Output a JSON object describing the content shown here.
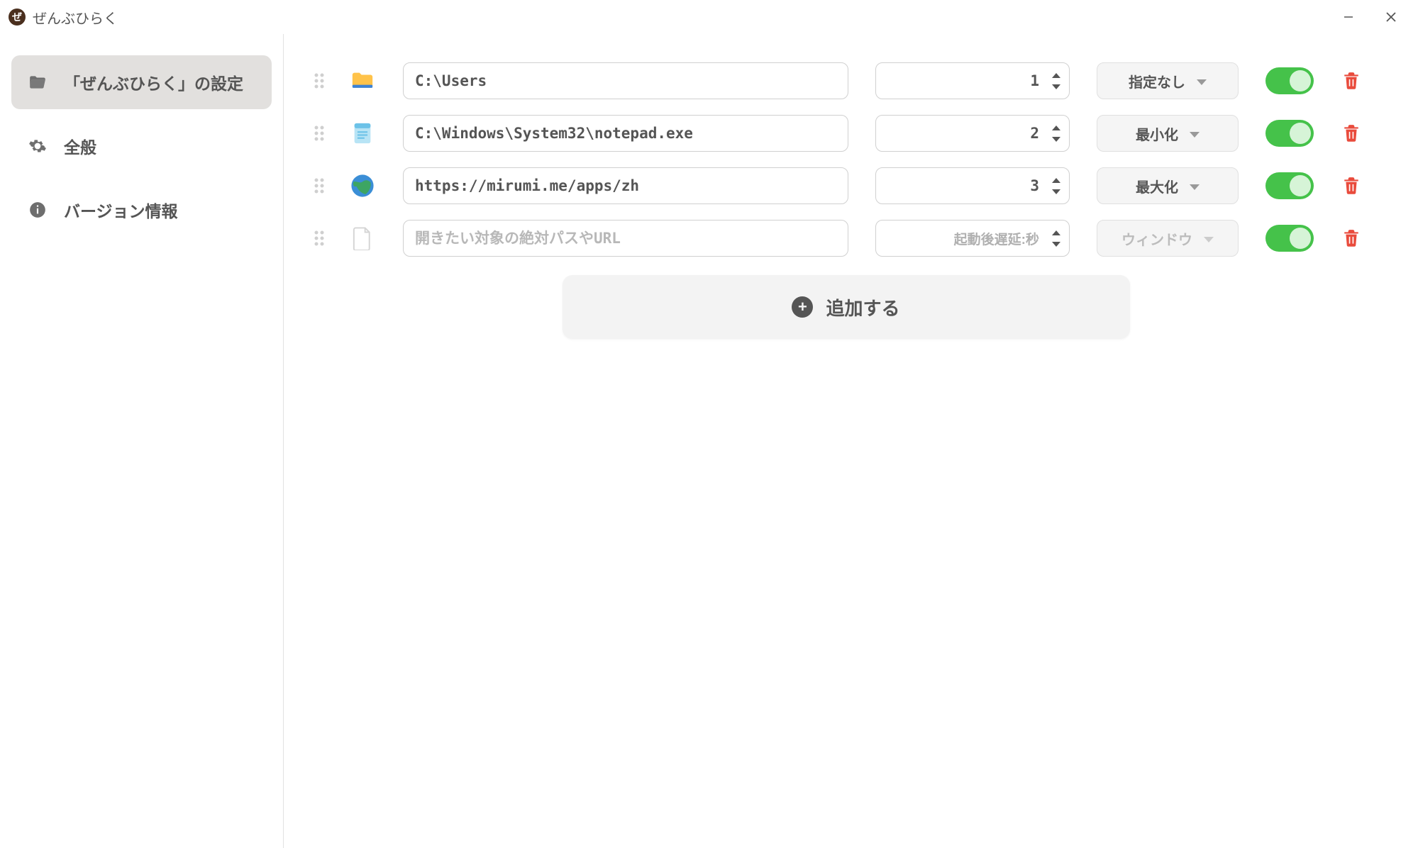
{
  "titlebar": {
    "app_title": "ぜんぶひらく",
    "app_icon_char": "ぜ"
  },
  "sidebar": {
    "items": [
      {
        "label": "「ぜんぶひらく」の設定"
      },
      {
        "label": "全般"
      },
      {
        "label": "バージョン情報"
      }
    ]
  },
  "rows": [
    {
      "path": "C:\\Users",
      "delay": "1",
      "window": "指定なし",
      "icon": "folder"
    },
    {
      "path": "C:\\Windows\\System32\\notepad.exe",
      "delay": "2",
      "window": "最小化",
      "icon": "notepad"
    },
    {
      "path": "https://mirumi.me/apps/zh",
      "delay": "3",
      "window": "最大化",
      "icon": "globe"
    },
    {
      "path": "",
      "delay": "",
      "window": "ウィンドウ",
      "icon": "file"
    }
  ],
  "placeholders": {
    "path": "開きたい対象の絶対パスやURL",
    "delay": "起動後遅延:秒"
  },
  "add_button": {
    "label": "追加する"
  }
}
